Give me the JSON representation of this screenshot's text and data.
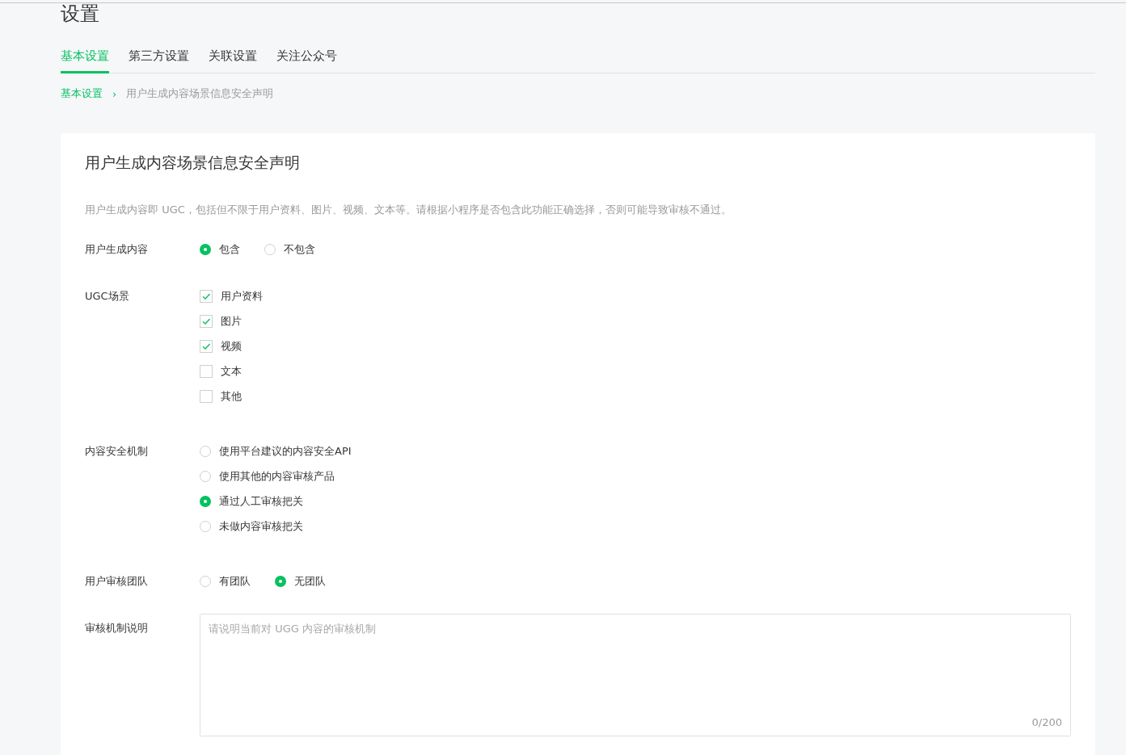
{
  "page_title": "设置",
  "tabs": [
    {
      "label": "基本设置",
      "selected": true
    },
    {
      "label": "第三方设置",
      "selected": false
    },
    {
      "label": "关联设置",
      "selected": false
    },
    {
      "label": "关注公众号",
      "selected": false
    }
  ],
  "breadcrumb": {
    "link": "基本设置",
    "separator": "›",
    "current": "用户生成内容场景信息安全声明"
  },
  "card": {
    "title": "用户生成内容场景信息安全声明",
    "description": "用户生成内容即 UGC，包括但不限于用户资料、图片、视频、文本等。请根据小程序是否包含此功能正确选择，否则可能导致审核不通过。",
    "fields": [
      {
        "kind": "radio-inline",
        "label": "用户生成内容",
        "options": [
          {
            "label": "包含",
            "selected": true
          },
          {
            "label": "不包含",
            "selected": false
          }
        ]
      },
      {
        "kind": "checkbox",
        "label": "UGC场景",
        "options": [
          {
            "label": "用户资料",
            "checked": true
          },
          {
            "label": "图片",
            "checked": true
          },
          {
            "label": "视频",
            "checked": true
          },
          {
            "label": "文本",
            "checked": false
          },
          {
            "label": "其他",
            "checked": false
          }
        ]
      },
      {
        "kind": "radio",
        "label": "内容安全机制",
        "options": [
          {
            "label": "使用平台建议的内容安全API",
            "selected": false
          },
          {
            "label": "使用其他的内容审核产品",
            "selected": false
          },
          {
            "label": "通过人工审核把关",
            "selected": true
          },
          {
            "label": "未做内容审核把关",
            "selected": false
          }
        ]
      },
      {
        "kind": "radio-inline",
        "label": "用户审核团队",
        "options": [
          {
            "label": "有团队",
            "selected": false
          },
          {
            "label": "无团队",
            "selected": true
          }
        ]
      },
      {
        "kind": "textarea",
        "label": "审核机制说明",
        "placeholder": "请说明当前对 UGG 内容的审核机制",
        "counter": "0/200"
      }
    ]
  }
}
